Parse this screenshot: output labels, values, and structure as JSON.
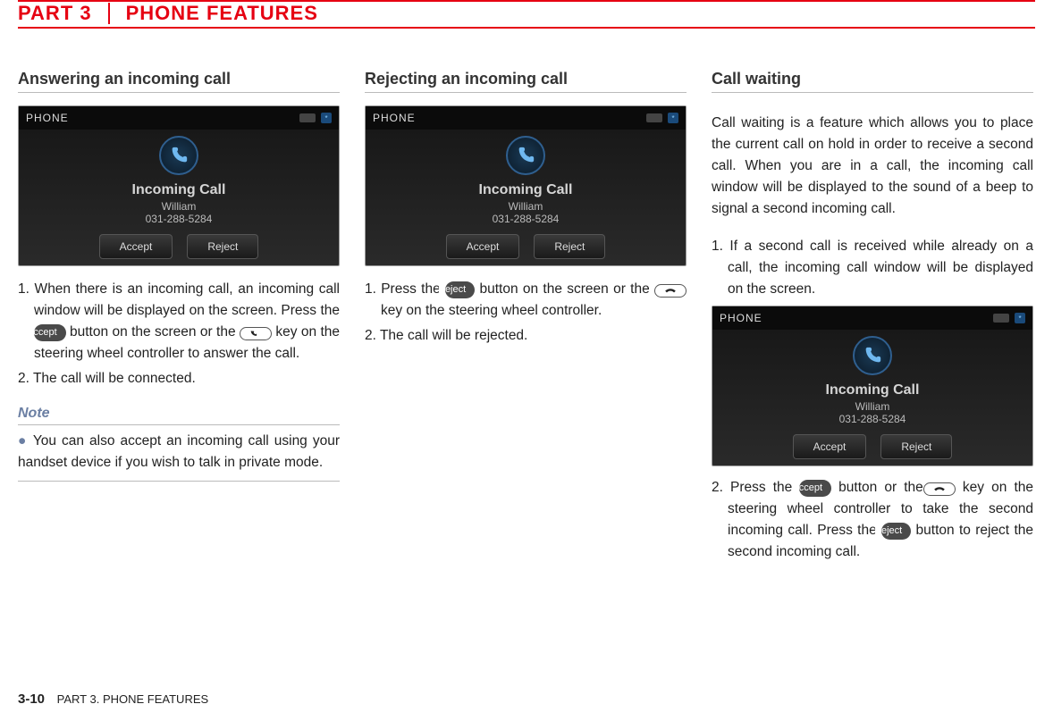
{
  "header": {
    "part": "PART 3",
    "title": "PHONE FEATURES"
  },
  "columns": {
    "answering": {
      "heading": "Answering an incoming call",
      "screenshot": {
        "topbar_title": "PHONE",
        "dialog_title": "Incoming Call",
        "caller_name": "William",
        "caller_number": "031-288-5284",
        "accept_btn": "Accept",
        "reject_btn": "Reject"
      },
      "step1_a": "1. When there is an incoming call, an incoming call window will be displayed on the screen. Press the ",
      "accept_pill": "Accept",
      "step1_b": " button on the screen or the ",
      "step1_c": " key on the steering wheel controller to answer the call.",
      "step2": "2. The call will be connected.",
      "note_heading": "Note",
      "note_body": " You can also accept an incoming call using your handset device if you wish to talk in private mode."
    },
    "rejecting": {
      "heading": "Rejecting an incoming call",
      "screenshot": {
        "topbar_title": "PHONE",
        "dialog_title": "Incoming Call",
        "caller_name": "William",
        "caller_number": "031-288-5284",
        "accept_btn": "Accept",
        "reject_btn": "Reject"
      },
      "step1_a": "1. Press the ",
      "reject_pill": "Reject",
      "step1_b": " button on the screen or the ",
      "step1_c": " key on the steering wheel controller.",
      "step2": "2. The call will be rejected."
    },
    "waiting": {
      "heading": "Call waiting",
      "intro": "Call waiting is a feature which allows you to place the current call on hold in order to receive a second call. When you are in a call, the incoming call window will be displayed to the sound of a beep to signal a second incoming call.",
      "step1": "1.  If a second call is received while already on a call, the incoming call window will be displayed on the screen.",
      "screenshot": {
        "topbar_title": "PHONE",
        "dialog_title": "Incoming Call",
        "caller_name": "William",
        "caller_number": "031-288-5284",
        "accept_btn": "Accept",
        "reject_btn": "Reject"
      },
      "step2_a": "2. Press the ",
      "accept_pill": "Accept",
      "step2_b": " button or the",
      "step2_c": " key on the steering wheel controller to take the second incoming call. Press the ",
      "reject_pill": "Reject",
      "step2_d": " button to reject the second incoming call."
    }
  },
  "footer": {
    "page_number": "3-10",
    "section": "PART 3. PHONE FEATURES"
  }
}
